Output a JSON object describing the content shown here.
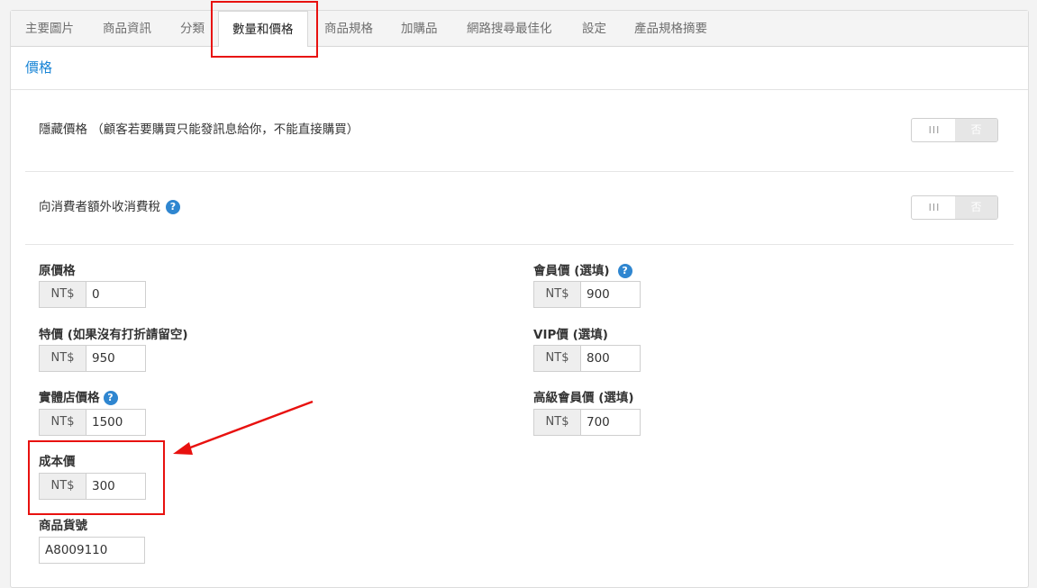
{
  "tabs": [
    {
      "label": "主要圖片"
    },
    {
      "label": "商品資訊"
    },
    {
      "label": "分類"
    },
    {
      "label": "數量和價格",
      "active": true
    },
    {
      "label": "商品規格"
    },
    {
      "label": "加購品"
    },
    {
      "label": "網路搜尋最佳化"
    },
    {
      "label": "設定"
    },
    {
      "label": "產品規格摘要"
    }
  ],
  "section_title": "價格",
  "hide_price": {
    "label": "隱藏價格 （顧客若要購買只能發訊息給你，不能直接購買）",
    "toggle_on": "III",
    "toggle_off": "否"
  },
  "extra_tax": {
    "label": "向消費者額外收消費稅",
    "toggle_on": "III",
    "toggle_off": "否"
  },
  "currency": "NT$",
  "help_glyph": "?",
  "fields": {
    "original_price": {
      "label": "原價格",
      "value": "0"
    },
    "special_price": {
      "label": "特價 (如果沒有打折請留空)",
      "value": "950"
    },
    "store_price": {
      "label": "實體店價格",
      "value": "1500"
    },
    "cost_price": {
      "label": "成本價",
      "value": "300"
    },
    "member_price": {
      "label": "會員價 (選填)",
      "value": "900"
    },
    "vip_price": {
      "label": "VIP價 (選填)",
      "value": "800"
    },
    "premium_price": {
      "label": "高級會員價 (選填)",
      "value": "700"
    },
    "sku": {
      "label": "商品貨號",
      "value": "A8009110"
    }
  },
  "colors": {
    "accent": "#1a85d6",
    "highlight": "#e8110f"
  }
}
